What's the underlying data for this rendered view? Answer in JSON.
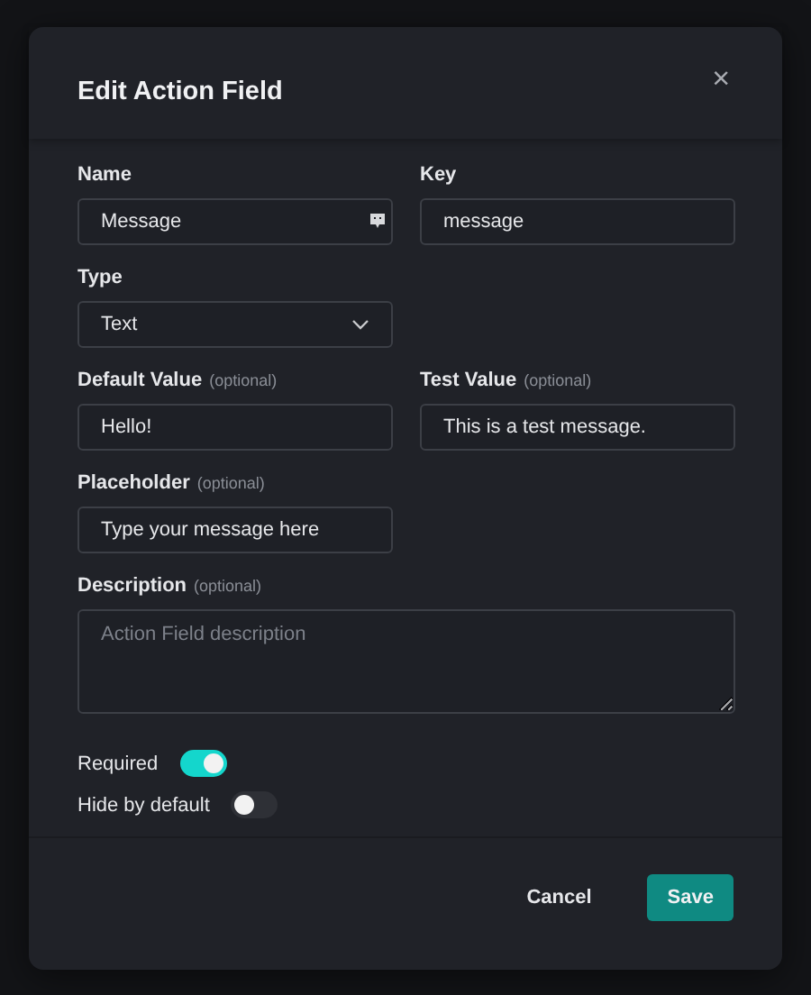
{
  "dialog": {
    "title": "Edit Action Field",
    "close": "×"
  },
  "rows": [
    [
      {
        "kind": "icon-text",
        "label": "Name",
        "value": "Message"
      },
      {
        "kind": "text",
        "label": "Key",
        "value": "message"
      }
    ],
    [
      {
        "kind": "select",
        "label": "Type",
        "value": "Text"
      }
    ],
    [
      {
        "kind": "text",
        "label": "Default Value",
        "optional": "(optional)",
        "value": "Hello!"
      },
      {
        "kind": "text",
        "label": "Test Value",
        "optional": "(optional)",
        "value": "This is a test message."
      }
    ],
    [
      {
        "kind": "text",
        "label": "Placeholder",
        "optional": "(optional)",
        "value": "Type your message here"
      }
    ],
    [
      {
        "kind": "textarea",
        "label": "Description",
        "optional": "(optional)",
        "placeholder": "Action Field description"
      }
    ]
  ],
  "toggles": [
    {
      "label": "Required",
      "on": true
    },
    {
      "label": "Hide by default",
      "on": false
    }
  ],
  "buttons": [
    {
      "kind": "secondary",
      "label": "Cancel"
    },
    {
      "kind": "primary",
      "label": "Save"
    }
  ]
}
